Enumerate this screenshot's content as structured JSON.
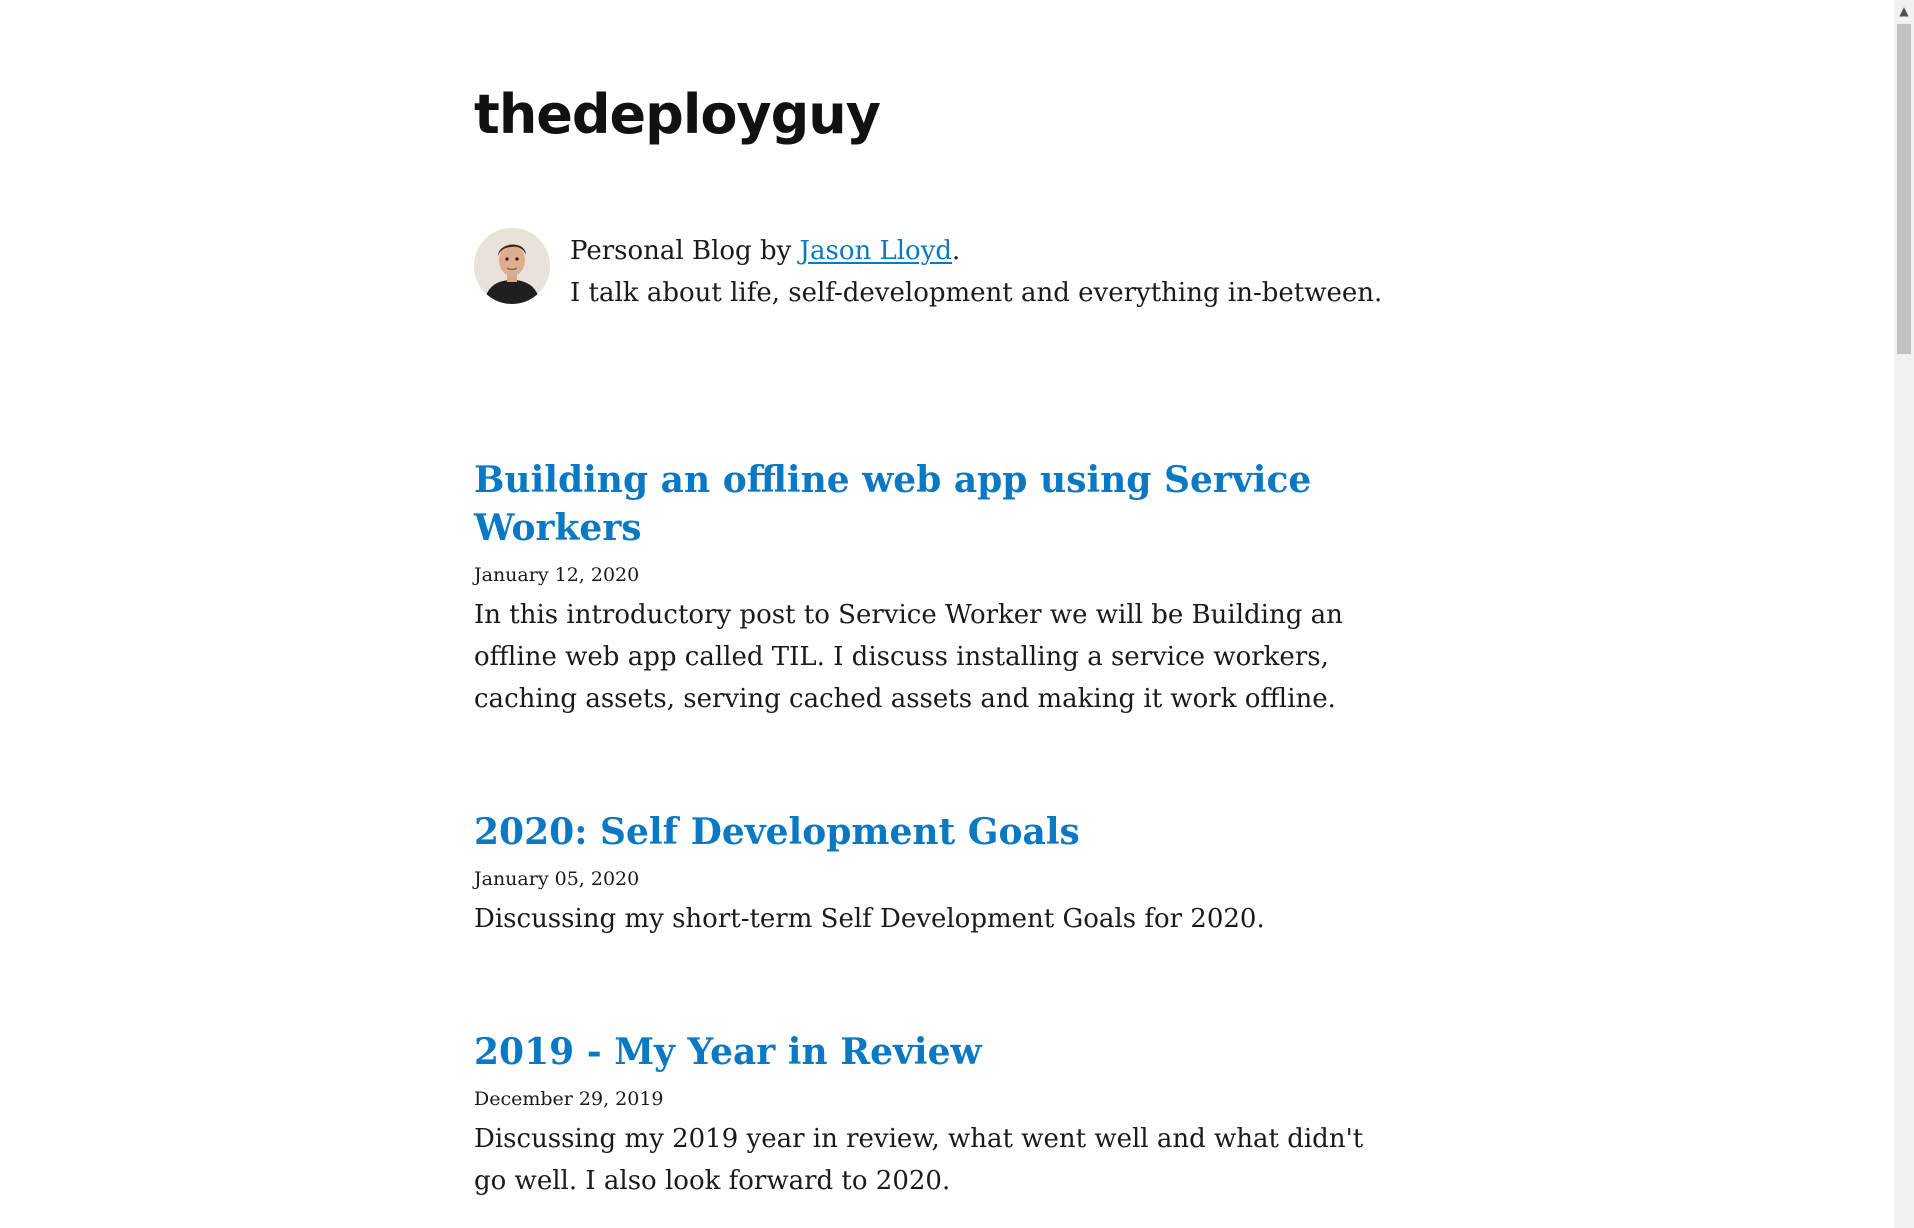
{
  "site": {
    "title": "thedeployguy"
  },
  "bio": {
    "line1_prefix": "Personal Blog by ",
    "author_name": "Jason Lloyd",
    "line1_suffix": ".",
    "line2": "I talk about life, self-development and everything in-between."
  },
  "posts": [
    {
      "title": "Building an offline web app using Service Workers",
      "date": "January 12, 2020",
      "excerpt": "In this introductory post to Service Worker we will be Building an offline web app called TIL. I discuss installing a service workers, caching assets, serving cached assets and making it work offline."
    },
    {
      "title": "2020: Self Development Goals",
      "date": "January 05, 2020",
      "excerpt": "Discussing my short-term Self Development Goals for 2020."
    },
    {
      "title": "2019 - My Year in Review",
      "date": "December 29, 2019",
      "excerpt": "Discussing my 2019 year in review, what went well and what didn't go well. I also look forward to 2020."
    }
  ],
  "colors": {
    "link": "#0a78c2",
    "text": "#1a1a1a",
    "background": "#ffffff"
  },
  "icons": {
    "scroll_up": "chevron-up-icon"
  }
}
